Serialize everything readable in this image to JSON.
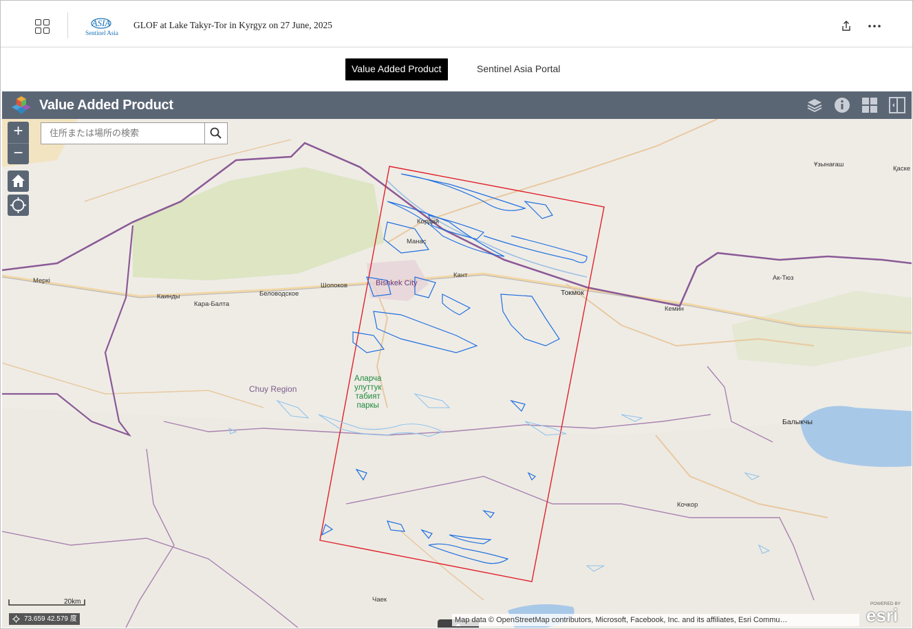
{
  "header": {
    "title": "GLOF at Lake Takyr-Tor in Kyrgyz on 27 June, 2025",
    "logo_text": "Sentinel Asia"
  },
  "nav": {
    "active_tab": "Value Added Product",
    "link_tab": "Sentinel Asia Portal"
  },
  "map_bar": {
    "title": "Value Added Product"
  },
  "search": {
    "placeholder": "住所または場所の検索"
  },
  "map": {
    "labels": {
      "city": "Bishkek City",
      "kordai": "Кордай",
      "manas": "Манас",
      "kant": "Кант",
      "tokmok": "Токмок",
      "shopokov": "Шопоков",
      "belovodskoe": "Беловодское",
      "kara_balta": "Кара-Балта",
      "kaindy": "Каинды",
      "merki": "Меркі",
      "kemin": "Кемин",
      "ak_tyuz": "Ак-Тюз",
      "uzynagash": "Ұзынағаш",
      "kaskelen": "Қаске",
      "balykchy": "Балыкчы",
      "kochkor": "Кочкор",
      "chaek": "Чаек",
      "region": "Chuy Region",
      "park_line1": "Аларча",
      "park_line2": "улуттук",
      "park_line3": "табият",
      "park_line4": "паркы"
    },
    "scale_label": "20km",
    "coordinates": "73.659 42.579 度",
    "attribution": "Map data © OpenStreetMap contributors, Microsoft, Facebook, Inc. and its affiliates, Esri Commu…",
    "esri_powered": "POWERED BY",
    "esri_brand": "esri",
    "colors": {
      "flood": "#1f6fe0",
      "aoi": "#e0202a",
      "border": "#8a5a96",
      "lake": "#a8c8e8",
      "vegetation": "#d6e3b4"
    }
  }
}
